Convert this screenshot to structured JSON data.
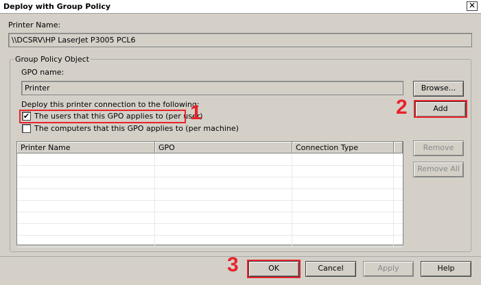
{
  "window": {
    "title": "Deploy with Group Policy",
    "close_label": "✕"
  },
  "printer": {
    "label": "Printer Name:",
    "value": "\\\\DCSRV\\HP LaserJet P3005 PCL6"
  },
  "group": {
    "title": "Group Policy Object",
    "gpo_label": "GPO name:",
    "gpo_value": "Printer",
    "browse_label": "Browse...",
    "deploy_label": "Deploy this printer connection to the following:",
    "per_user": {
      "label": "The users that this GPO applies to (per user)",
      "checked": true,
      "mark": "✔"
    },
    "per_machine": {
      "label": "The computers that this GPO applies to (per machine)",
      "checked": false,
      "mark": ""
    },
    "add_label": "Add",
    "remove_label": "Remove",
    "remove_all_label": "Remove All"
  },
  "list": {
    "columns": [
      "Printer Name",
      "GPO",
      "Connection Type"
    ],
    "rows": []
  },
  "footer": {
    "ok_label": "OK",
    "cancel_label": "Cancel",
    "apply_label": "Apply",
    "help_label": "Help"
  },
  "annotations": {
    "callout_1": "1",
    "callout_2": "2",
    "callout_3": "3",
    "color": "#e8222a"
  }
}
